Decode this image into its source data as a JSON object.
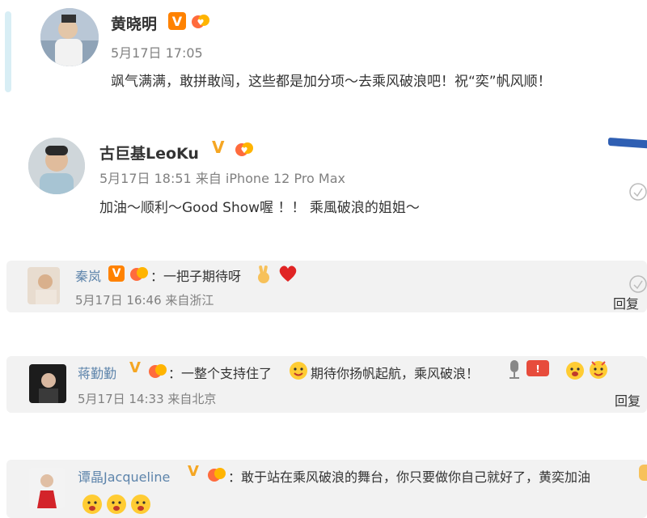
{
  "colors": {
    "accent_orange": "#ff8200",
    "link_blue": "#5d84ab",
    "meta_gray": "#808080",
    "reply_bg": "#f2f2f2"
  },
  "posts": [
    {
      "name": "黄晓明",
      "meta": "5月17日 17:05",
      "text": "飒气满满，敢拼敢闯，这些都是加分项～去乘风破浪吧！祝“奕”帆风顺！"
    },
    {
      "name": "古巨基LeoKu",
      "meta": "5月17日 18:51 来自 iPhone 12 Pro Max",
      "text": "加油～顺利～Good Show喔 ！！ 乘風破浪的姐姐～"
    }
  ],
  "replies": [
    {
      "name": "秦岚",
      "text": "：一把子期待呀",
      "meta": "5月17日 16:46 来自浙江",
      "reply_label": "回复"
    },
    {
      "name": "蒋勤勤",
      "text_a": "：一整个支持住了",
      "text_b": "期待你扬帆起航，乘风破浪！",
      "meta": "5月17日 14:33 来自北京",
      "reply_label": "回复"
    },
    {
      "name": "谭晶Jacqueline",
      "text": "：敢于站在乘风破浪的舞台，你只要做你自己就好了，黄奕加油"
    }
  ],
  "icons": [
    "verified-v-icon",
    "level-badge-icon",
    "like-icon",
    "victory-hand-emoji",
    "heart-emoji",
    "cheering-face-emoji",
    "microphone-icon",
    "cheer-sticker-icon"
  ]
}
